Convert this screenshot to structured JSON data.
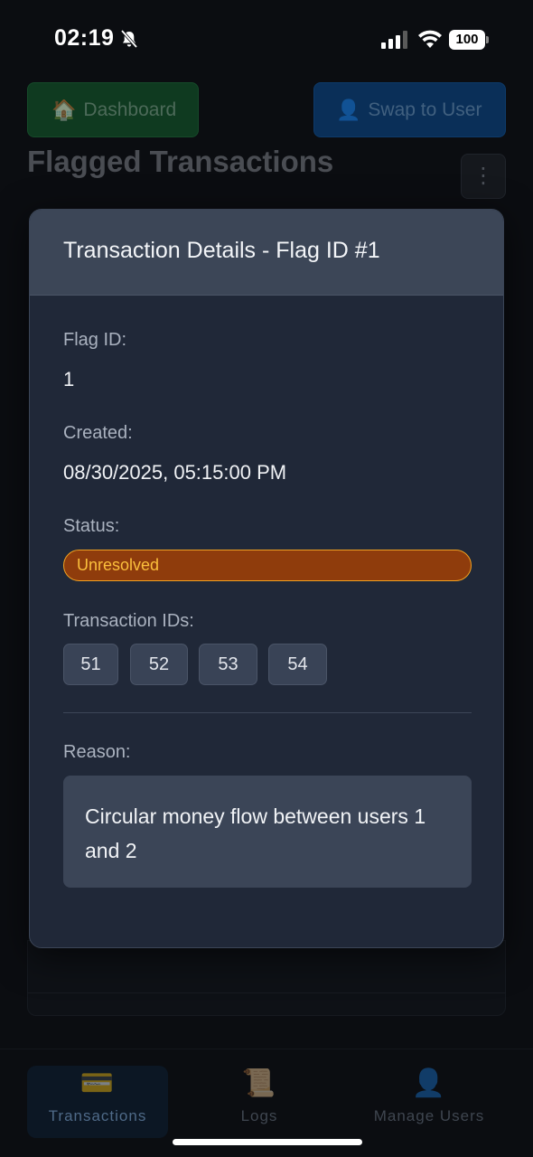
{
  "status_bar": {
    "time": "02:19",
    "battery": "100"
  },
  "header": {
    "dashboard_label": "Dashboard",
    "swap_label": "Swap to User",
    "page_title": "Flagged Transactions",
    "menu_glyph": "⋮"
  },
  "modal": {
    "title": "Transaction Details - Flag ID #1",
    "flag_id_label": "Flag ID:",
    "flag_id_value": "1",
    "created_label": "Created:",
    "created_value": "08/30/2025, 05:15:00 PM",
    "status_label": "Status:",
    "status_value": "Unresolved",
    "transaction_ids_label": "Transaction IDs:",
    "transaction_ids": [
      "51",
      "52",
      "53",
      "54"
    ],
    "reason_label": "Reason:",
    "reason_value": "Circular money flow between users 1 and 2"
  },
  "bottom_nav": {
    "items": [
      {
        "label": "Transactions",
        "icon": "credit-card-icon",
        "active": true
      },
      {
        "label": "Logs",
        "icon": "scroll-icon",
        "active": false
      },
      {
        "label": "Manage Users",
        "icon": "user-icon",
        "active": false
      }
    ]
  },
  "colors": {
    "status_bg": "#8f3c0c",
    "status_border": "#f0a020",
    "status_text": "#fbbf3c",
    "modal_bg": "#202838",
    "modal_header_bg": "#3c4657"
  }
}
